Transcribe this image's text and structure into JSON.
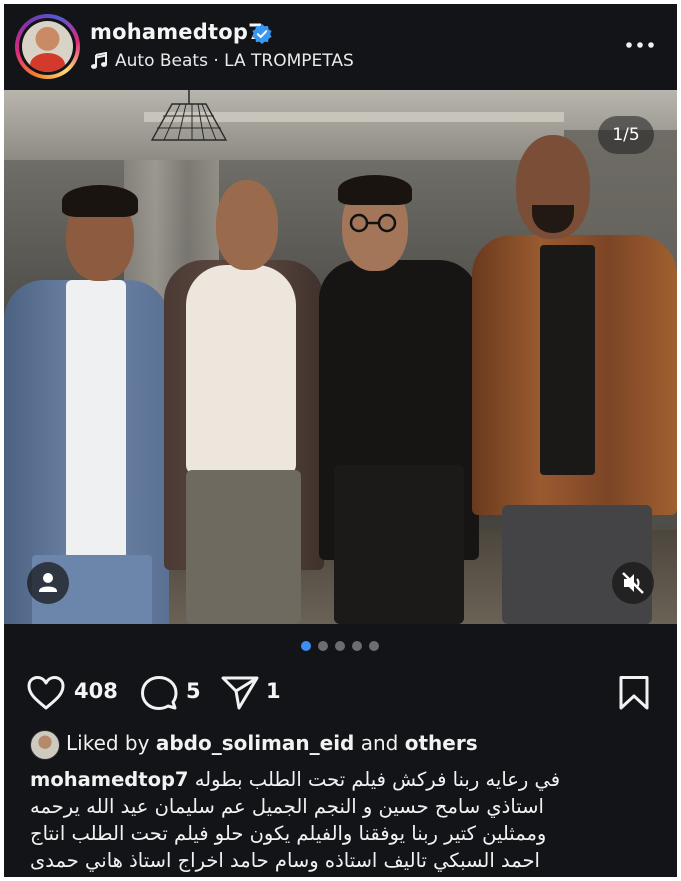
{
  "header": {
    "username": "mohamedtop7",
    "song": "Auto Beats · LA TROMPETAS"
  },
  "photo": {
    "counter": "1/5"
  },
  "carousel": {
    "total": 5,
    "active_index": 0
  },
  "actions": {
    "likes": "408",
    "comments": "5",
    "shares": "1"
  },
  "liked_by": {
    "prefix": "Liked by",
    "user": "abdo_soliman_eid",
    "middle": "and",
    "suffix": "others"
  },
  "caption": {
    "user": "mohamedtop7",
    "line1": "في رعايه ربنا  فركش فيلم تحت الطلب بطوله",
    "line2": "استاذي سامح حسين و النجم الجميل عم سليمان عيد الله يرحمه",
    "line3": "وممثلين كتير ربنا يوفقنا والفيلم يكون حلو  فيلم تحت الطلب انتاج",
    "line4": "احمد السبكي تاليف استاذه وسام حامد  اخراج استاذ هاني حمدى"
  },
  "icons": {
    "verified": "verified-badge-icon",
    "music": "music-note-icon",
    "more": "more-options-icon",
    "heart": "heart-icon",
    "comment": "comment-icon",
    "share": "share-icon",
    "save": "bookmark-icon",
    "tag": "person-tag-icon",
    "mute": "speaker-muted-icon"
  },
  "colors": {
    "background": "#121418",
    "verified": "#3897f0",
    "active_dot": "#3c8ef5",
    "inactive_dot": "#6a6d73"
  }
}
